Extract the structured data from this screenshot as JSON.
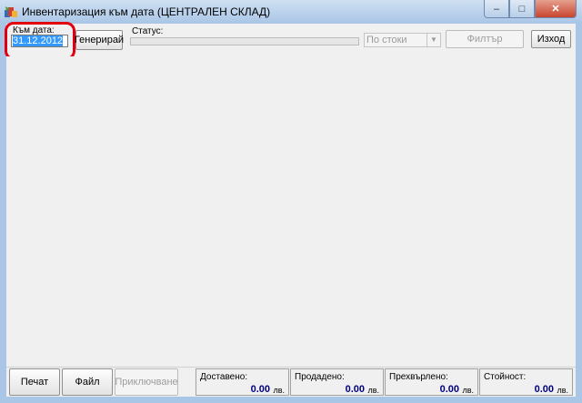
{
  "window": {
    "title": "Инвентаризация към дата (ЦЕНТРАЛЕН СКЛАД)",
    "min_label": "–",
    "max_label": "□",
    "close_label": "✕"
  },
  "toolbar": {
    "date_label": "Към дата:",
    "date_value": "31.12.2012",
    "generate_label": "Генерирай",
    "status_label": "Статус:",
    "group_select_value": "По стоки",
    "filter_label": "Филтър",
    "exit_label": "Изход"
  },
  "footer": {
    "print_label": "Печат",
    "file_label": "Файл",
    "finish_label": "Приключване",
    "totals": [
      {
        "label": "Доставено:",
        "value": "0.00",
        "currency": "лв."
      },
      {
        "label": "Продадено:",
        "value": "0.00",
        "currency": "лв."
      },
      {
        "label": "Прехвърлено:",
        "value": "0.00",
        "currency": "лв."
      },
      {
        "label": "Стойност:",
        "value": "0.00",
        "currency": "лв."
      }
    ]
  },
  "colors": {
    "highlight": "#e00010",
    "total_value": "#000080",
    "selection": "#3399ff"
  }
}
